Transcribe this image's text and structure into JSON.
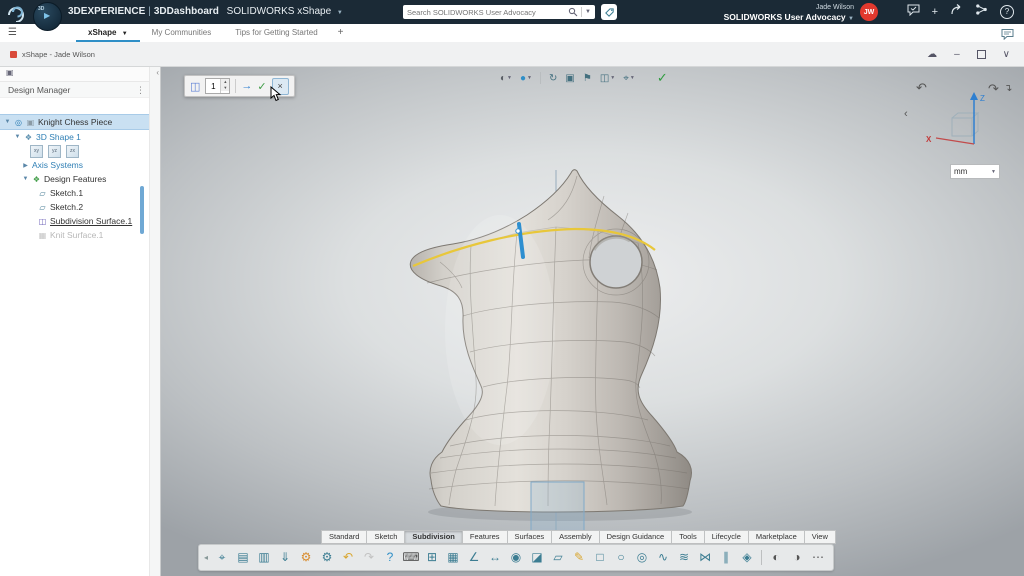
{
  "colors": {
    "topbar_bg": "#1b2a36",
    "accent_blue": "#2f8fc7",
    "avatar_red": "#e2392e",
    "icon_teal": "#3c7d92",
    "selection_blue": "#c9e0f2",
    "tree_blue_text": "#2f7fb5",
    "highlight_yellow": "#e8c73a",
    "handle_blue": "#2e8fd0"
  },
  "top_bar": {
    "brand": "3DEXPERIENCE",
    "pipe": "|",
    "dashboard": "3DDashboard",
    "app_name": "SOLIDWORKS xShape",
    "search_placeholder": "Search SOLIDWORKS User Advocacy",
    "user_line1": "Jade Wilson",
    "user_line2": "SOLIDWORKS User Advocacy",
    "avatar_initials": "JW"
  },
  "community_bar": {
    "tabs": [
      {
        "label": "xShape",
        "active": true
      },
      {
        "label": "My Communities",
        "active": false
      },
      {
        "label": "Tips for Getting Started",
        "active": false
      }
    ],
    "add_tab": "+"
  },
  "window_bar": {
    "title": "xShape - Jade Wilson"
  },
  "left_panel": {
    "header": "Design Manager",
    "tree": {
      "root_label": "Knight Chess Piece",
      "shape_label": "3D Shape 1",
      "axis_systems_label": "Axis Systems",
      "design_features_label": "Design Features",
      "sketch1_label": "Sketch.1",
      "sketch2_label": "Sketch.2",
      "subdivision_label": "Subdivision Surface.1",
      "disabled_label": "Knit Surface.1"
    }
  },
  "subdivision_toolbar": {
    "level_value": "1"
  },
  "viewport": {
    "units": "mm",
    "triad_z": "Z",
    "triad_x": "X"
  },
  "ribbon_tabs": [
    {
      "label": "Standard"
    },
    {
      "label": "Sketch"
    },
    {
      "label": "Subdivision",
      "active": true
    },
    {
      "label": "Features"
    },
    {
      "label": "Surfaces"
    },
    {
      "label": "Assembly"
    },
    {
      "label": "Design Guidance"
    },
    {
      "label": "Tools"
    },
    {
      "label": "Lifecycle"
    },
    {
      "label": "Marketplace"
    },
    {
      "label": "View"
    }
  ],
  "bottom_toolbar": {
    "icons": [
      {
        "name": "pan-zoom-icon",
        "glyph": "⌖",
        "color": "#3c7d92"
      },
      {
        "name": "open-icon",
        "glyph": "▤",
        "color": "#3c7d92"
      },
      {
        "name": "save-icon",
        "glyph": "▥",
        "color": "#3c7d92"
      },
      {
        "name": "import-icon",
        "glyph": "⇓",
        "color": "#3c7d92"
      },
      {
        "name": "settings-gear-icon",
        "glyph": "⚙",
        "color": "#d98b2b"
      },
      {
        "name": "automation-gear-icon",
        "glyph": "⚙",
        "color": "#3c7d92"
      },
      {
        "name": "undo-icon",
        "glyph": "↶",
        "color": "#d9a62e"
      },
      {
        "name": "redo-icon",
        "glyph": "↷",
        "color": "#c2c2c2"
      },
      {
        "name": "help-icon",
        "glyph": "?",
        "color": "#2f8fc7"
      },
      {
        "name": "keyboard-icon",
        "glyph": "⌨",
        "color": "#555555"
      },
      {
        "name": "calculator-icon",
        "glyph": "⊞",
        "color": "#3c7d92"
      },
      {
        "name": "grid-icon",
        "glyph": "▦",
        "color": "#3c7d92"
      },
      {
        "name": "axes-icon",
        "glyph": "∠",
        "color": "#3c7d92"
      },
      {
        "name": "measure-icon",
        "glyph": "↔",
        "color": "#3c7d92"
      },
      {
        "name": "visibility-eye-icon",
        "glyph": "◉",
        "color": "#3c7d92"
      },
      {
        "name": "section-icon",
        "glyph": "◪",
        "color": "#3c7d92"
      },
      {
        "name": "plane-icon",
        "glyph": "▱",
        "color": "#3c7d92"
      },
      {
        "name": "sketch-pencil-icon",
        "glyph": "✎",
        "color": "#d9a62e"
      },
      {
        "name": "box-primitive-icon",
        "glyph": "□",
        "color": "#3c7d92"
      },
      {
        "name": "sphere-primitive-icon",
        "glyph": "○",
        "color": "#3c7d92"
      },
      {
        "name": "cylinder-primitive-icon",
        "glyph": "◎",
        "color": "#3c7d92"
      },
      {
        "name": "curve-icon",
        "glyph": "∿",
        "color": "#3c7d92"
      },
      {
        "name": "loft-icon",
        "glyph": "≋",
        "color": "#3c7d92"
      },
      {
        "name": "symmetry-icon",
        "glyph": "⋈",
        "color": "#3c7d92"
      },
      {
        "name": "mirror-icon",
        "glyph": "∥",
        "color": "#3c7d92"
      },
      {
        "name": "thicken-icon",
        "glyph": "◈",
        "color": "#3c7d92"
      },
      {
        "separator": true
      },
      {
        "name": "display-mode-icon",
        "glyph": "◐",
        "color": "#555555"
      },
      {
        "name": "ambient-occlusion-icon",
        "glyph": "◑",
        "color": "#555555"
      },
      {
        "name": "more-options-icon",
        "glyph": "⋯",
        "color": "#555555"
      }
    ]
  }
}
